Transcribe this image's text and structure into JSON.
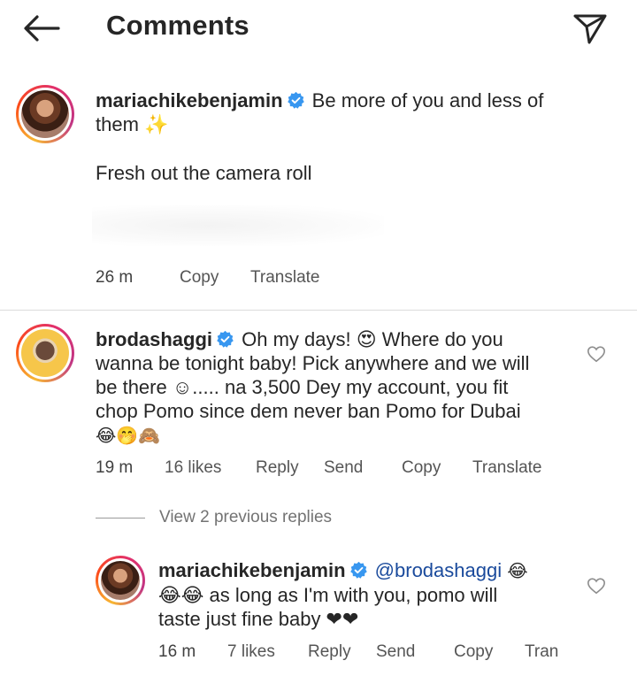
{
  "header": {
    "title": "Comments"
  },
  "caption": {
    "username": "mariachikebenjamin",
    "text_line1": "Be more of you and less of",
    "text_line2": "them ✨",
    "text_line3": "Fresh out the camera roll",
    "time": "26 m",
    "copy": "Copy",
    "translate": "Translate"
  },
  "comment1": {
    "username": "brodashaggi",
    "line1": "Oh my days! 😍 Where do you",
    "line2": "wanna be tonight baby! Pick anywhere and we will",
    "line3": "be there ☺..... na 3,500 Dey my account, you fit",
    "line4": "chop Pomo since dem never ban Pomo for Dubai",
    "line5": "😂🤭🙈",
    "time": "19 m",
    "likes": "16 likes",
    "reply": "Reply",
    "send": "Send",
    "copy": "Copy",
    "translate": "Translate"
  },
  "view_replies": "View 2 previous replies",
  "reply1": {
    "username": "mariachikebenjamin",
    "mention": "@brodashaggi",
    "line1_tail": "😂",
    "line2": "😂😂 as long as I'm with you, pomo will",
    "line3": "taste just fine baby ❤❤",
    "time": "16 m",
    "likes": "7 likes",
    "reply": "Reply",
    "send": "Send",
    "copy": "Copy",
    "translate": "Tran"
  },
  "colors": {
    "verified": "#3897f0",
    "text": "#262626",
    "muted": "#737373",
    "mention": "#1a4a9c"
  }
}
